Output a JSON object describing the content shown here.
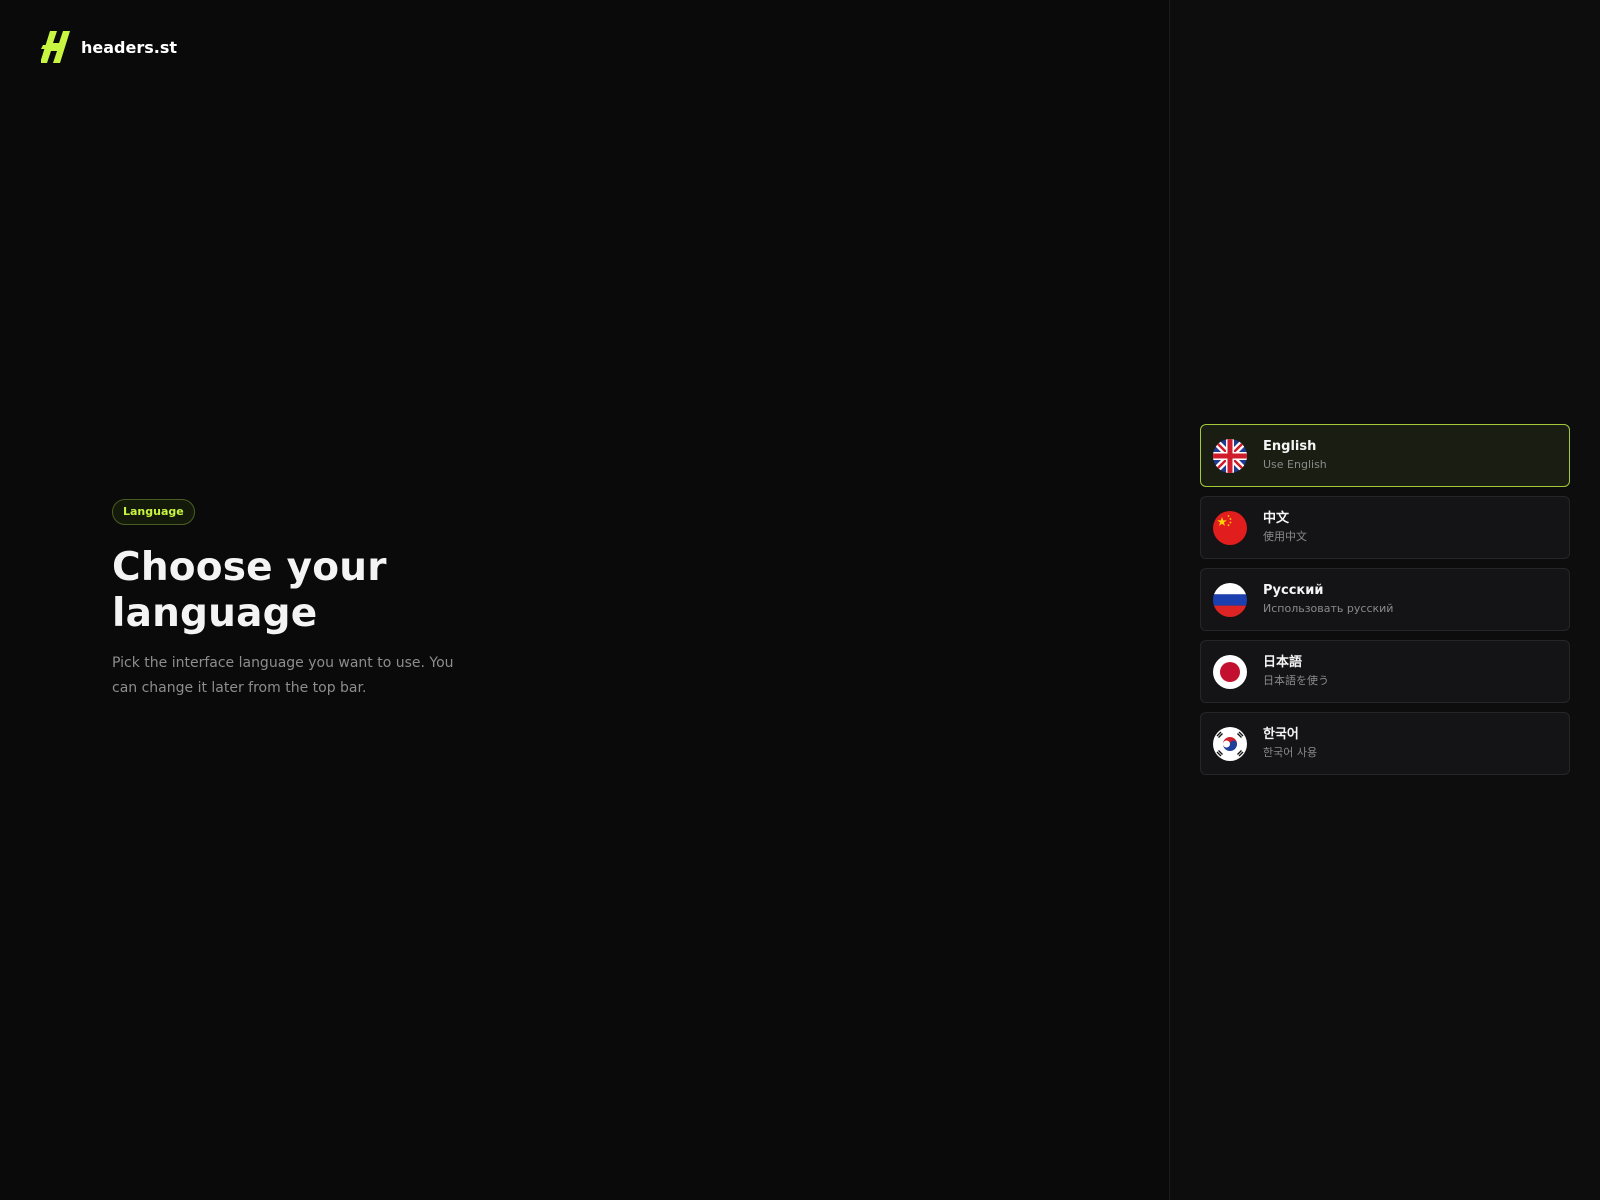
{
  "brand": {
    "name": "headers.st",
    "logo_icon": "headers-logo-icon",
    "accent": "#c8f542"
  },
  "intro": {
    "badge": "Language",
    "title": "Choose your language",
    "subtitle": "Pick the interface language you want to use. You can change it later from the top bar."
  },
  "languages": [
    {
      "name": "English",
      "subtitle": "Use English",
      "flag": "uk-flag-icon",
      "selected": true
    },
    {
      "name": "中文",
      "subtitle": "使用中文",
      "flag": "china-flag-icon",
      "selected": false
    },
    {
      "name": "Русский",
      "subtitle": "Использовать русский",
      "flag": "russia-flag-icon",
      "selected": false
    },
    {
      "name": "日本語",
      "subtitle": "日本語を使う",
      "flag": "japan-flag-icon",
      "selected": false
    },
    {
      "name": "한국어",
      "subtitle": "한국어 사용",
      "flag": "korea-flag-icon",
      "selected": false
    }
  ]
}
